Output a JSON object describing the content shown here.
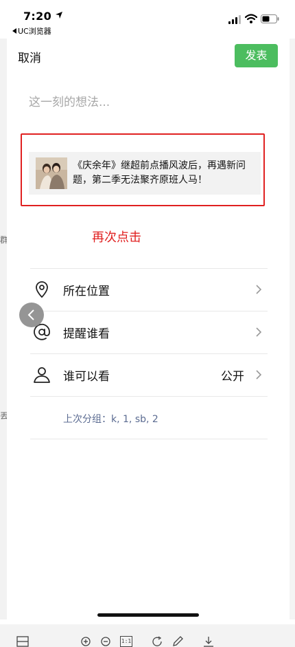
{
  "status_bar": {
    "time": "7:20",
    "back_app": "UC浏览器"
  },
  "header": {
    "cancel_label": "取消",
    "publish_label": "发表",
    "publish_color": "#4cbd5f"
  },
  "composer": {
    "placeholder": "这一刻的想法..."
  },
  "shared_article": {
    "title": "《庆余年》继超前点播风波后，再遇新问题，第二季无法聚齐原班人马！"
  },
  "annotation": {
    "text": "再次点击",
    "color": "#e02020"
  },
  "options": [
    {
      "icon": "location-pin-icon",
      "label": "所在位置",
      "value": ""
    },
    {
      "icon": "at-mention-icon",
      "label": "提醒谁看",
      "value": ""
    },
    {
      "icon": "person-icon",
      "label": "谁可以看",
      "value": "公开"
    }
  ],
  "last_group": {
    "text": "上次分组：k, 1, sb, 2"
  },
  "background_fragments": [
    "群",
    "丟"
  ],
  "toolbar": {
    "icons": [
      "grid-icon",
      "zoom-in-icon",
      "zoom-out-icon",
      "actual-size-icon",
      "rotate-icon",
      "edit-icon",
      "download-icon"
    ],
    "actual_size_label": "1:1"
  }
}
